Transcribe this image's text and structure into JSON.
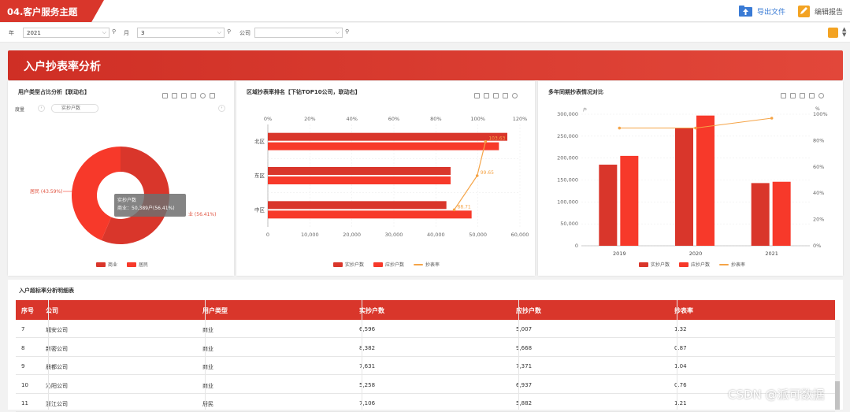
{
  "app": {
    "title": "04.客户服务主题",
    "export_label": "导出文件",
    "edit_label": "编辑报告"
  },
  "filters": {
    "year_label": "年",
    "year_value": "2021",
    "month_label": "月",
    "month_value": "3",
    "company_label": "公司",
    "company_value": ""
  },
  "section_title": "入户抄表率分析",
  "panel1": {
    "title": "用户类型占比分析【联动右】",
    "dimension_label": "度量",
    "measure_button": "实抄户数",
    "tooltip_title": "实抄户数",
    "tooltip_text": "商业：50,389户(56.41%)",
    "label_resident": "居民 (43.59%)",
    "label_business": "业 (56.41%)"
  },
  "panel2": {
    "title": "区域抄表率排名【下钻TOP10公司，联动右】"
  },
  "panel3": {
    "title": "多年同期抄表情况对比",
    "y_unit": "户",
    "y2_unit": "%"
  },
  "chart_data": [
    {
      "type": "pie",
      "categories": [
        "商业",
        "居民"
      ],
      "values": [
        56.41,
        43.59
      ],
      "colors": [
        "#d9362b",
        "#f7392a"
      ]
    },
    {
      "type": "bar",
      "orientation": "horizontal",
      "categories": [
        "北区",
        "东区",
        "中区"
      ],
      "series": [
        {
          "name": "实抄户数",
          "values": [
            57000,
            43500,
            42500
          ]
        },
        {
          "name": "应抄户数",
          "values": [
            55000,
            43500,
            48500
          ]
        },
        {
          "name": "抄表率",
          "values": [
            103.63,
            99.65,
            88.71
          ],
          "type": "line",
          "labels": [
            "103.63",
            "99.65",
            "88.71"
          ]
        }
      ],
      "xlim": [
        0,
        60000
      ],
      "xticks": [
        "0",
        "10,000",
        "20,000",
        "30,000",
        "40,000",
        "50,000",
        "60,000"
      ],
      "x2lim": [
        0,
        120
      ],
      "x2ticks": [
        "0%",
        "20%",
        "40%",
        "60%",
        "80%",
        "100%",
        "120%"
      ],
      "x2unit": "%",
      "colors": [
        "#d9362b",
        "#f7392a",
        "#f5a447"
      ]
    },
    {
      "type": "bar",
      "categories": [
        "2019",
        "2020",
        "2021"
      ],
      "series": [
        {
          "name": "实抄户数",
          "values": [
            185000,
            268000,
            143000
          ]
        },
        {
          "name": "应抄户数",
          "values": [
            205000,
            297000,
            146000
          ]
        },
        {
          "name": "抄表率",
          "values": [
            89.5,
            89.5,
            97
          ],
          "type": "line"
        }
      ],
      "ylim": [
        0,
        300000
      ],
      "yticks": [
        "0",
        "50,000",
        "100,000",
        "150,000",
        "200,000",
        "250,000",
        "300,000"
      ],
      "y2lim": [
        0,
        100
      ],
      "y2ticks": [
        "0%",
        "20%",
        "40%",
        "60%",
        "80%",
        "100%"
      ],
      "colors": [
        "#d9362b",
        "#f7392a",
        "#f5a447"
      ]
    }
  ],
  "table": {
    "title": "入户超标率分析明细表",
    "headers": [
      "序号",
      "公司",
      "用户类型",
      "实抄户数",
      "应抄户数",
      "抄表率"
    ],
    "rows": [
      [
        "7",
        "城安公司",
        "商业",
        "6,596",
        "5,007",
        "1.32"
      ],
      [
        "8",
        "新密公司",
        "商业",
        "8,382",
        "9,668",
        "0.87"
      ],
      [
        "9",
        "晨都公司",
        "商业",
        "7,631",
        "7,371",
        "1.04"
      ],
      [
        "10",
        "沁阳公司",
        "商业",
        "5,258",
        "6,937",
        "0.76"
      ],
      [
        "11",
        "浙江公司",
        "居民",
        "7,106",
        "5,882",
        "1.21"
      ]
    ]
  },
  "watermark": "CSDN @派可数据",
  "colors": {
    "brand_red": "#d9362b",
    "bar_red2": "#f7392a",
    "line_orange": "#f5a447",
    "accent_blue": "#3a7bd5"
  }
}
